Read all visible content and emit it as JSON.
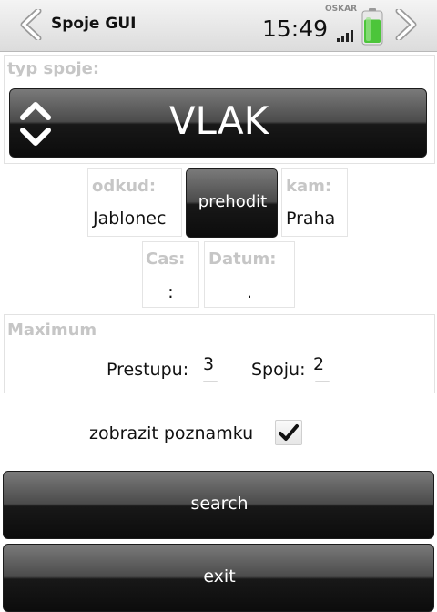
{
  "statusbar": {
    "title": "Spoje GUI",
    "time": "15:49",
    "operator": "OSKAR",
    "battery_level": 0.85,
    "signal_bars": 4
  },
  "type_section": {
    "label": "typ spoje:",
    "value": "VLAK"
  },
  "route": {
    "from_label": "odkud:",
    "from_value": "Jablonec",
    "swap_button": "prehodit",
    "to_label": "kam:",
    "to_value": "Praha"
  },
  "time_date": {
    "time_label": "Cas:",
    "time_value": ":",
    "date_label": "Datum:",
    "date_value": "."
  },
  "maximum": {
    "label": "Maximum",
    "transfers_label": "Prestupu:",
    "transfers_value": "3",
    "connections_label": "Spoju:",
    "connections_value": "2"
  },
  "note": {
    "label": "zobrazit poznamku",
    "checked": true
  },
  "actions": {
    "search_label": "search",
    "exit_label": "exit"
  },
  "colors": {
    "button_dark": "#181818",
    "label_gray": "#c6c6c6",
    "battery_green": "#4cc53a"
  }
}
